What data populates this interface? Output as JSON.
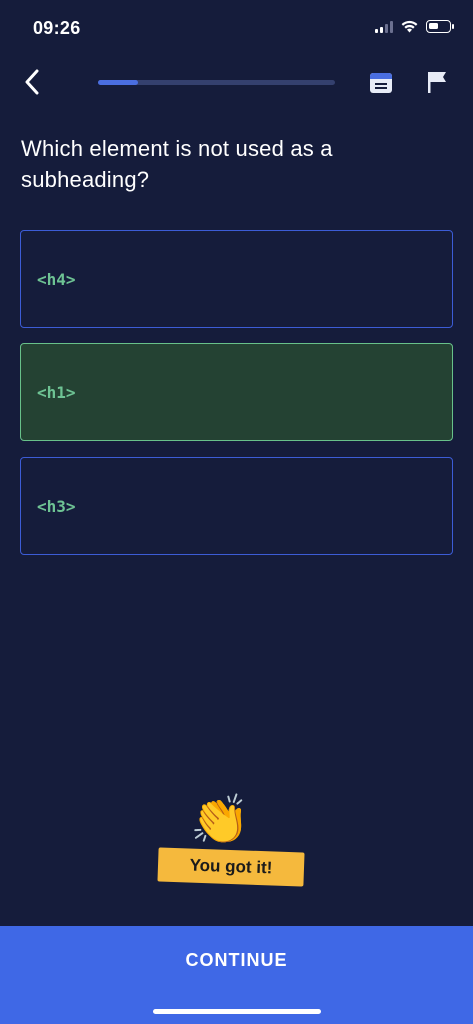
{
  "status_bar": {
    "time": "09:26",
    "battery_level": 0.45
  },
  "nav": {
    "back_icon": "chevron-left-icon",
    "progress": 0.17,
    "notes_icon": "notes-icon",
    "flag_icon": "flag-icon"
  },
  "question": {
    "text": "Which element is not used as a subheading?"
  },
  "options": [
    {
      "label": "<h4>",
      "state": "default"
    },
    {
      "label": "<h1>",
      "state": "correct"
    },
    {
      "label": "<h3>",
      "state": "default"
    }
  ],
  "feedback": {
    "icon": "clapping-hands-icon",
    "text": "You got it!"
  },
  "continue": {
    "label": "CONTINUE"
  },
  "colors": {
    "background": "#151c3b",
    "accent": "#3f68e6",
    "correct_bg": "#244233",
    "correct_border": "#68c18a",
    "code_text": "#6ec394",
    "badge": "#f5b93d"
  }
}
